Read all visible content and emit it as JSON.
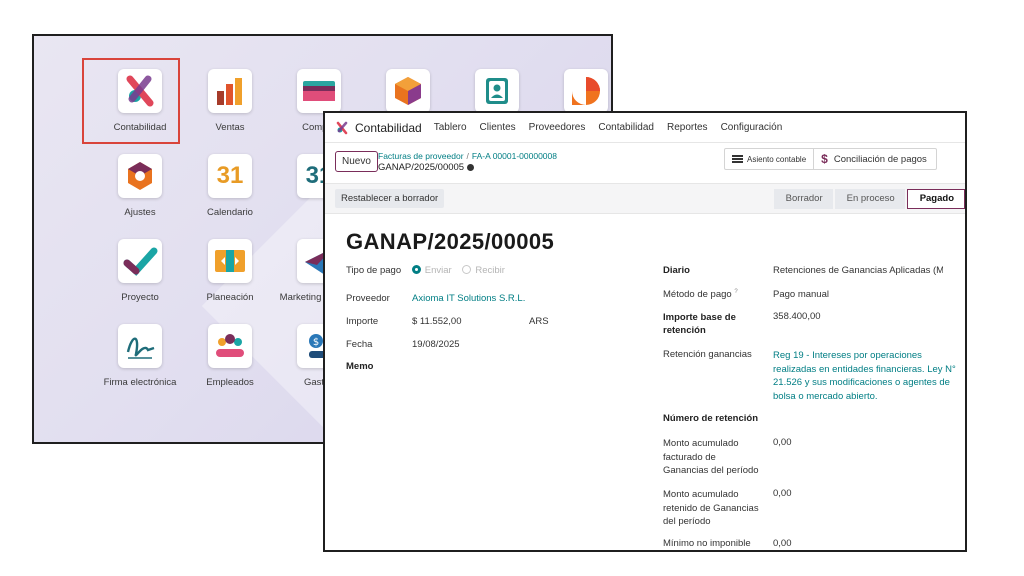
{
  "launcher": {
    "apps": [
      {
        "label": "Contabilidad",
        "icon": "accounting-icon",
        "selected": true
      },
      {
        "label": "Ventas",
        "icon": "sales-icon"
      },
      {
        "label": "Compra",
        "icon": "purchase-icon"
      },
      {
        "label": "",
        "icon": "inventory-icon"
      },
      {
        "label": "",
        "icon": "contacts-icon"
      },
      {
        "label": "",
        "icon": "discuss-icon"
      },
      {
        "label": "Ajustes",
        "icon": "settings-icon"
      },
      {
        "label": "Calendario",
        "icon": "calendar-icon",
        "glyph": "31"
      },
      {
        "label": "",
        "icon": "calendar-check-icon",
        "glyph": "31"
      },
      {
        "label": "Proyecto",
        "icon": "project-icon"
      },
      {
        "label": "Planeación",
        "icon": "planning-icon"
      },
      {
        "label": "Marketing por co...",
        "icon": "email-marketing-icon"
      },
      {
        "label": "Firma electrónica",
        "icon": "sign-icon"
      },
      {
        "label": "Empleados",
        "icon": "employees-icon"
      },
      {
        "label": "Gastos",
        "icon": "expenses-icon"
      }
    ]
  },
  "navbar": {
    "brand": "Contabilidad",
    "menus": [
      "Tablero",
      "Clientes",
      "Proveedores",
      "Contabilidad",
      "Reportes",
      "Configuración"
    ]
  },
  "control": {
    "new_label": "Nuevo",
    "breadcrumb_parent": "Facturas de proveedor",
    "breadcrumb_current": "FA-A 00001-00000008",
    "record_name": "GANAP/2025/00005",
    "smart_buttons": [
      "Asiento contable",
      "Conciliación de pagos"
    ]
  },
  "status": {
    "reset_label": "Restablecer a borrador",
    "stages": [
      "Borrador",
      "En proceso",
      "Pagado"
    ],
    "active_stage": "Pagado"
  },
  "form": {
    "title": "GANAP/2025/00005",
    "payment_type_label": "Tipo de pago",
    "payment_type_options": [
      "Enviar",
      "Recibir"
    ],
    "payment_type_selected": "Enviar",
    "vendor_label": "Proveedor",
    "vendor_value": "Axioma IT Solutions S.R.L.",
    "amount_label": "Importe",
    "amount_value": "$ 11.552,00",
    "currency": "ARS",
    "date_label": "Fecha",
    "date_value": "19/08/2025",
    "memo_label": "Memo",
    "journal_label": "Diario",
    "journal_value": "Retenciones de Ganancias Aplicadas (M",
    "method_label": "Método de pago",
    "method_help": "?",
    "method_value": "Pago manual",
    "base_label": "Importe base de retención",
    "base_value": "358.400,00",
    "retention_label": "Retención ganancias",
    "retention_value": "Reg 19 - Intereses por operaciones realizadas en entidades financieras. Ley N° 21.526 y sus modificaciones o agentes de bolsa o mercado abierto.",
    "retention_number_label": "Número de retención",
    "acc_invoiced_label": "Monto acumulado facturado de Ganancias del período",
    "acc_invoiced_value": "0,00",
    "acc_withheld_label": "Monto acumulado retenido de Ganancias del período",
    "acc_withheld_value": "0,00",
    "min_label": "Mínimo no imponible",
    "min_value": "0,00"
  },
  "colors": {
    "brand": "#7a2d5a",
    "link": "#017e84",
    "highlight": "#d9443b"
  }
}
